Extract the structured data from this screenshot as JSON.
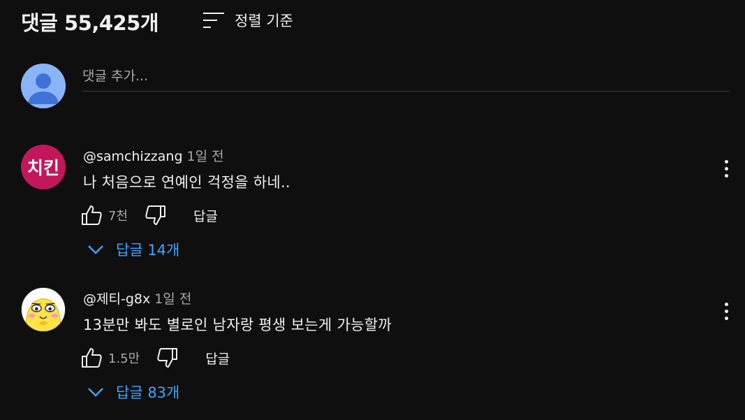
{
  "header": {
    "count_title": "댓글 55,425개",
    "sort_label": "정렬 기준"
  },
  "add_comment": {
    "placeholder": "댓글 추가..."
  },
  "comments": [
    {
      "avatar_text": "치킨",
      "author": "@samchizzang",
      "time": "1일 전",
      "text": "나 처음으로 연예인 걱정을 하네..",
      "likes": "7천",
      "reply_label": "답글",
      "replies_label": "답글 14개"
    },
    {
      "author": "@제티-g8x",
      "time": "1일 전",
      "text": "13분만 봐도 별로인 남자랑 평생 보는게 가능할까",
      "likes": "1.5만",
      "reply_label": "답글",
      "replies_label": "답글 83개"
    }
  ],
  "colors": {
    "background": "#0f0f0f",
    "link_blue": "#3ea6ff",
    "secondary_text": "#aaaaaa",
    "avatar1_bg": "#c2185b",
    "my_avatar_bg": "#8ab4f8"
  },
  "icons": [
    "sort-icon",
    "default-avatar-icon",
    "thumbs-up-icon",
    "thumbs-down-icon",
    "more-vert-icon",
    "chevron-down-icon"
  ]
}
